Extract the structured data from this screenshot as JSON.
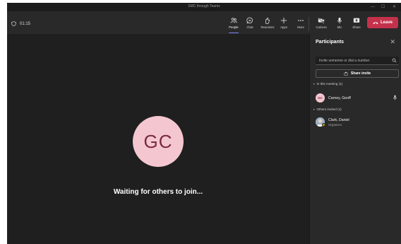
{
  "window": {
    "title": "SMC through Teams",
    "min_glyph": "—",
    "max_glyph": "☐",
    "close_glyph": "✕"
  },
  "toolbar": {
    "timer": "01:15",
    "buttons": [
      {
        "id": "people",
        "label": "People",
        "icon": "people-icon",
        "active": true
      },
      {
        "id": "chat",
        "label": "Chat",
        "icon": "chat-icon"
      },
      {
        "id": "reactions",
        "label": "Reactions",
        "icon": "reactions-icon"
      },
      {
        "id": "apps",
        "label": "Apps",
        "icon": "plus-icon"
      },
      {
        "id": "more",
        "label": "More",
        "icon": "more-icon"
      },
      {
        "id": "camera",
        "label": "Camera",
        "icon": "camera-off-icon"
      },
      {
        "id": "mic",
        "label": "Mic",
        "icon": "mic-icon"
      },
      {
        "id": "share",
        "label": "Share",
        "icon": "share-screen-icon"
      }
    ],
    "leave_label": "Leave"
  },
  "stage": {
    "avatar_initials": "GC",
    "waiting_text": "Waiting for others to join..."
  },
  "participants": {
    "title": "Participants",
    "close_glyph": "✕",
    "invite_placeholder": "Invite someone or dial a number",
    "share_invite_label": "Share invite",
    "in_meeting_header": "In this meeting (1)",
    "in_meeting": [
      {
        "initials": "GC",
        "name": "Carney, Geoff"
      }
    ],
    "others_header": "Others invited (1)",
    "others": [
      {
        "name": "Clark, Daniel",
        "role": "Organizer"
      }
    ]
  },
  "colors": {
    "accent": "#7f85f5",
    "leave": "#c4314b",
    "avatar_bg": "#f4c7d0",
    "avatar_text": "#7b2a3c",
    "background": "#1f1f1f",
    "panel": "#292929"
  }
}
